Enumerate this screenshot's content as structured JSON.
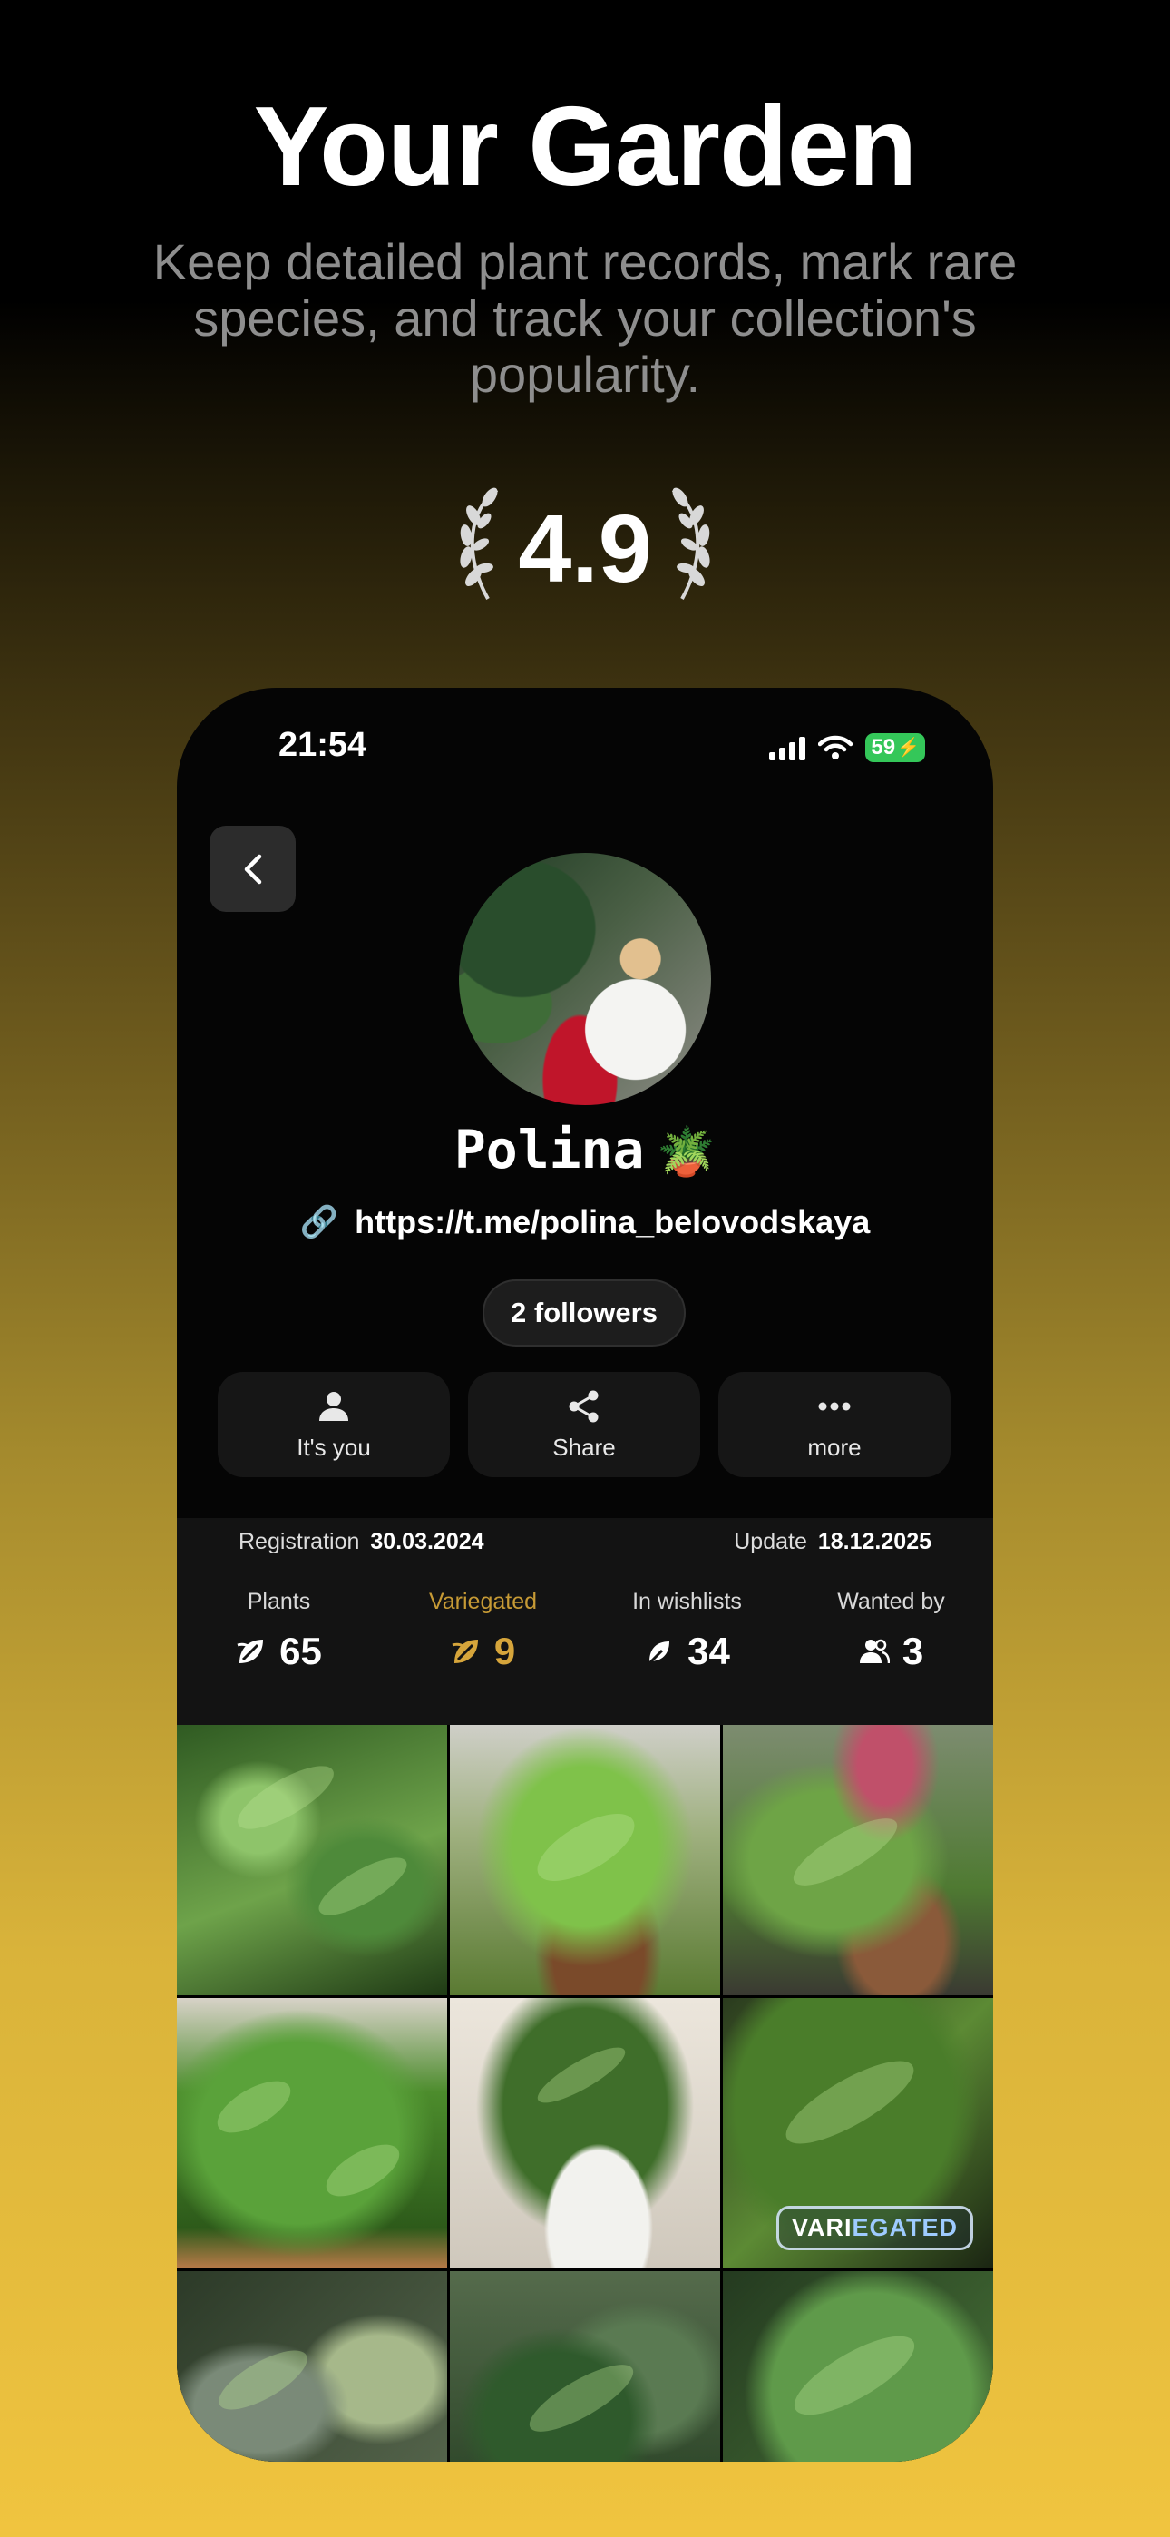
{
  "promo": {
    "title": "Your Garden",
    "subtitle": "Keep detailed plant records, mark rare species, and track your collection's popularity.",
    "rating": "4.9"
  },
  "status_bar": {
    "time": "21:54",
    "battery": "59"
  },
  "profile": {
    "name": "Polina",
    "name_emoji": "🪴",
    "link": "https://t.me/polina_belovodskaya",
    "followers": "2 followers"
  },
  "actions": [
    {
      "label": "It's you",
      "icon": "person-icon"
    },
    {
      "label": "Share",
      "icon": "share-icon"
    },
    {
      "label": "more",
      "icon": "more-icon"
    }
  ],
  "dates": {
    "registration_label": "Registration",
    "registration_value": "30.03.2024",
    "update_label": "Update",
    "update_value": "18.12.2025"
  },
  "stats": [
    {
      "label": "Plants",
      "value": "65",
      "icon": "leaf-icon"
    },
    {
      "label": "Variegated",
      "value": "9",
      "icon": "variegated-leaf-icon",
      "color": "#d6a53b"
    },
    {
      "label": "In wishlists",
      "value": "34",
      "icon": "small-leaf-icon"
    },
    {
      "label": "Wanted by",
      "value": "3",
      "icon": "people-icon"
    }
  ],
  "grid": {
    "badge_prefix": "VARI",
    "badge_highlight": "EGATED"
  }
}
